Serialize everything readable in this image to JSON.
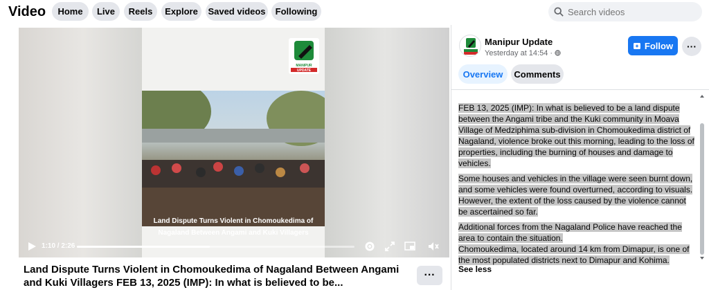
{
  "header": {
    "title": "Video",
    "nav": [
      "Home",
      "Live",
      "Reels",
      "Explore",
      "Saved videos",
      "Following"
    ],
    "search_placeholder": "Search videos"
  },
  "video": {
    "caption_line1": "Land Dispute Turns Violent in Chomoukedima of",
    "caption_line2": "Nagaland Between Angami and Kuki Villagers",
    "logo_text": "MANIPUR UPDATE",
    "time": "1:10 / 2:26",
    "progress": 0.48,
    "title": "Land Dispute Turns Violent in Chomoukedima of Nagaland Between Angami and Kuki Villagers FEB 13, 2025 (IMP): In what is believed to be...",
    "more_label": "···"
  },
  "panel": {
    "page_name": "Manipur Update",
    "posted": "Yesterday at 14:54 ·",
    "follow_label": "Follow",
    "more_label": "···",
    "tabs": [
      "Overview",
      "Comments"
    ],
    "paragraphs": [
      "FEB 13, 2025 (IMP): In what is believed to be a land dispute between the Angami tribe and the Kuki community in Moava Village of Medziphima sub-division in Chomoukedima district of Nagaland, violence broke out this morning, leading to the loss of properties, including the burning of houses and damage to vehicles.",
      "Some houses and vehicles in the village were seen burnt down, and some vehicles were found overturned, according to visuals. However, the extent of the loss caused by the violence cannot be ascertained so far.",
      "Additional forces from the Nagaland Police have reached the area to contain the situation.",
      "Chomoukedima, located around 14 km from Dimapur, is one of the most populated districts next to Dimapur and Kohima."
    ],
    "see_less": "See less"
  },
  "colors": {
    "accent": "#1877f2",
    "highlight": "#c6c6c6"
  }
}
